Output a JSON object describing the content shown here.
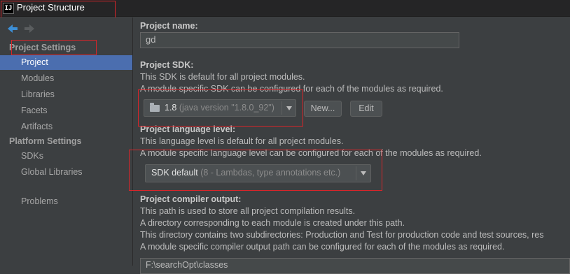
{
  "window": {
    "app_icon": "IJ",
    "title": "Project Structure"
  },
  "sidebar": {
    "sections": [
      {
        "title": "Project Settings",
        "items": [
          "Project",
          "Modules",
          "Libraries",
          "Facets",
          "Artifacts"
        ]
      },
      {
        "title": "Platform Settings",
        "items": [
          "SDKs",
          "Global Libraries"
        ]
      }
    ],
    "extra_item": "Problems",
    "selected": "Project"
  },
  "project_name": {
    "label": "Project name:",
    "value": "gd"
  },
  "project_sdk": {
    "label": "Project SDK:",
    "desc1": "This SDK is default for all project modules.",
    "desc2": "A module specific SDK can be configured for each of the modules as required.",
    "sdk_version": "1.8",
    "sdk_detail": "(java version \"1.8.0_92\")",
    "new_button": "New...",
    "edit_button": "Edit"
  },
  "language_level": {
    "label": "Project language level:",
    "desc1": "This language level is default for all project modules.",
    "desc2": "A module specific language level can be configured for each of the modules as required.",
    "value": "SDK default",
    "detail": "(8 - Lambdas, type annotations etc.)"
  },
  "compiler_output": {
    "label": "Project compiler output:",
    "desc1": "This path is used to store all project compilation results.",
    "desc2": "A directory corresponding to each module is created under this path.",
    "desc3": "This directory contains two subdirectories: Production and Test for production code and test sources, res",
    "desc4": "A module specific compiler output path can be configured for each of the modules as required.",
    "path": "F:\\searchOpt\\classes"
  },
  "icons": {
    "back": "arrow-left-icon",
    "forward": "arrow-right-icon",
    "folder": "folder-icon",
    "dropdown": "chevron-down-icon"
  },
  "colors": {
    "background": "#3c3f41",
    "selection": "#4b6eaf",
    "highlight_border": "#d9252a",
    "back_arrow": "#3d8fd6"
  }
}
